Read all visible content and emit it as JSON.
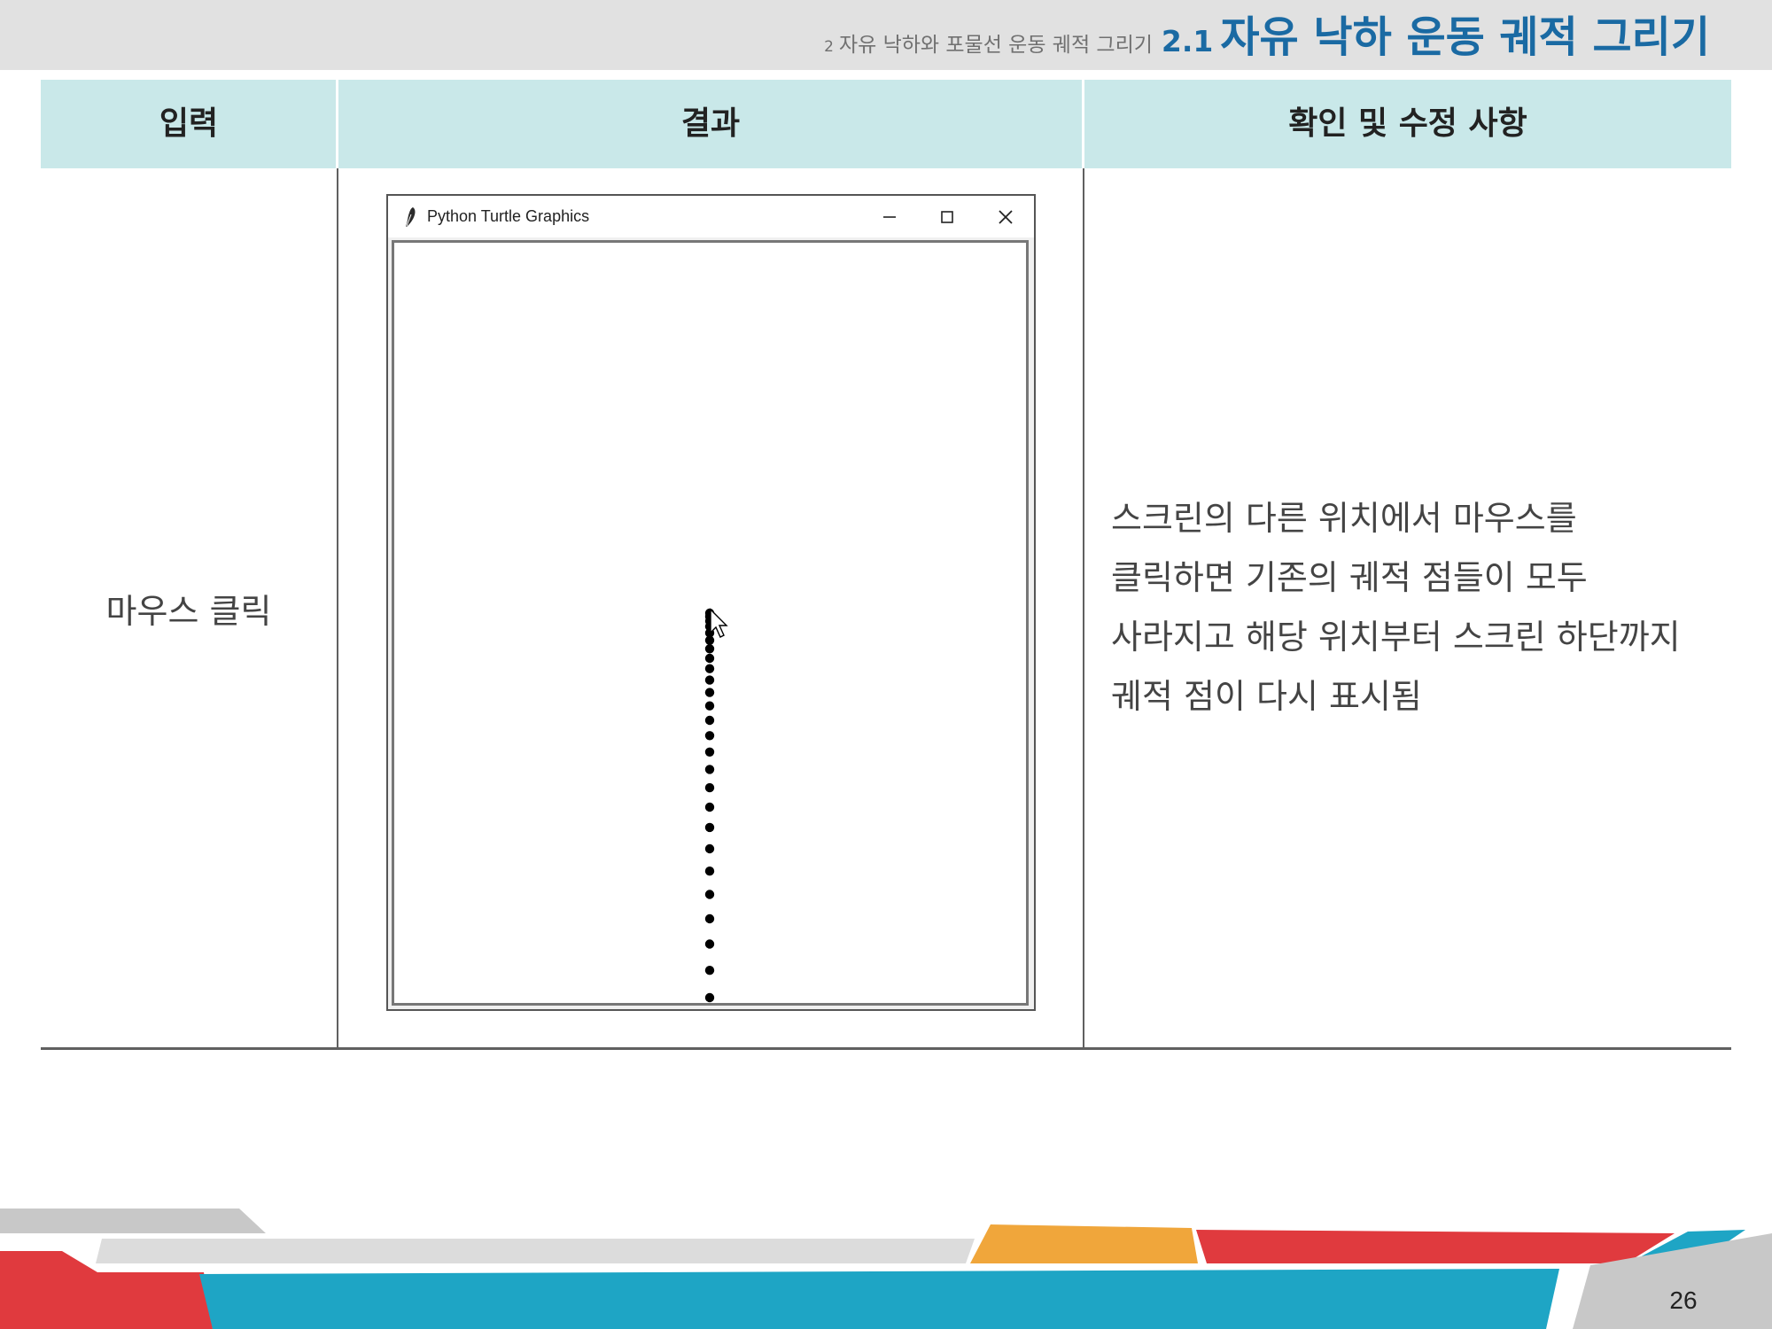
{
  "header": {
    "crumb_num": "2",
    "crumb_text": "자유 낙하와 포물선 운동 궤적 그리기",
    "section_num": "2.1",
    "section_title": "자유 낙하 운동 궤적 그리기"
  },
  "table": {
    "columns": [
      "입력",
      "결과",
      "확인 및 수정 사항"
    ],
    "rows": [
      {
        "input": "마우스 클릭",
        "note": "스크린의 다른 위치에서 마우스를 클릭하면 기존의 궤적 점들이 모두 사라지고 해당 위치부터 스크린 하단까지 궤적 점이 다시 표시됨"
      }
    ]
  },
  "turtle_window": {
    "title": "Python Turtle Graphics",
    "icons": {
      "app": "feather-icon",
      "minimize": "minimize-icon",
      "maximize": "maximize-icon",
      "close": "close-icon"
    },
    "trajectory_dot_count": 26,
    "cursor": "mouse-cursor-icon"
  },
  "colors": {
    "header_bg": "#e1e1e1",
    "title_blue": "#1a6aa3",
    "table_header_bg": "#c9e8e9",
    "footer_red": "#e03a3e",
    "footer_blue": "#1ea5c5",
    "footer_orange": "#f0a63b",
    "footer_gray": "#c8c8c8"
  },
  "footer": {
    "page_number": "26"
  }
}
